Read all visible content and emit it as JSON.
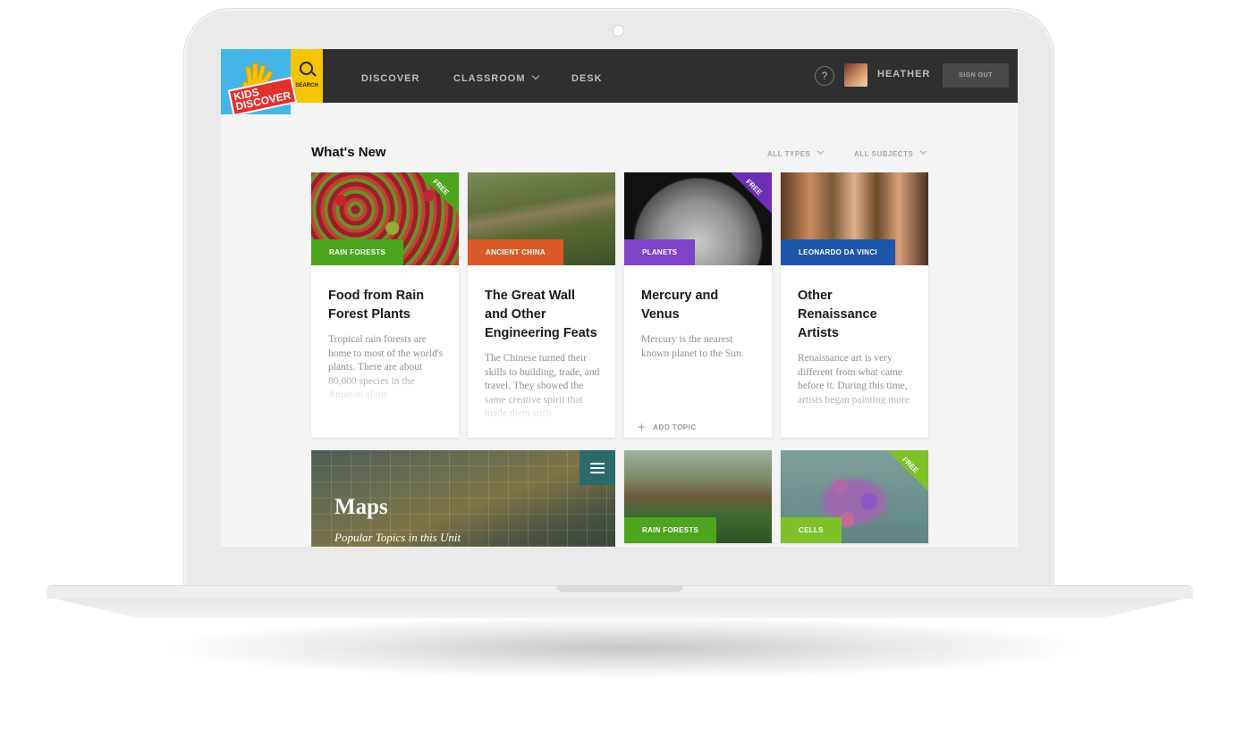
{
  "app": {
    "logo_text": "KIDS DISCOVER"
  },
  "header": {
    "search_label": "SEARCH",
    "nav": [
      {
        "label": "DISCOVER"
      },
      {
        "label": "CLASSROOM"
      },
      {
        "label": "DESK"
      }
    ],
    "help_label": "?",
    "user_name": "HEATHER",
    "signout_label": "SIGN OUT"
  },
  "main": {
    "section_title": "What's New",
    "filters": [
      {
        "label": "ALL TYPES"
      },
      {
        "label": "ALL SUBJECTS"
      }
    ],
    "cards": [
      {
        "tag": "RAIN FORESTS",
        "tag_color": "#4da51d",
        "free": "FREE",
        "ribbon_color": "#4da51d",
        "title": "Food from Rain Forest Plants",
        "desc": "Tropical rain forests are home to most of the world's plants. There are about 80,000 species in the Amazon alone."
      },
      {
        "tag": "ANCIENT CHINA",
        "tag_color": "#d95a27",
        "title": "The Great Wall and Other Engineering Feats",
        "desc": "The Chinese turned their skills to building, trade, and travel. They showed the same creative spirit that made them such"
      },
      {
        "tag": "PLANETS",
        "tag_color": "#7f43c8",
        "free": "FREE",
        "ribbon_color": "#6a2fb5",
        "title": "Mercury and Venus",
        "desc": "Mercury is the nearest known planet to the Sun.",
        "add_topic": "ADD TOPIC"
      },
      {
        "tag": "LEONARDO DA VINCI",
        "tag_color": "#1d56a8",
        "title": "Other Renaissance Artists",
        "desc": "Renaissance art is very different from what came before it. During this time, artists began painting more"
      }
    ],
    "unit": {
      "title": "Maps",
      "subtitle": "Popular Topics in this Unit"
    },
    "bottom_cards": [
      {
        "tag": "RAIN FORESTS",
        "tag_color": "#4da51d"
      },
      {
        "tag": "CELLS",
        "tag_color": "#7ec12a",
        "free": "FREE",
        "ribbon_color": "#7ec12a"
      }
    ]
  }
}
